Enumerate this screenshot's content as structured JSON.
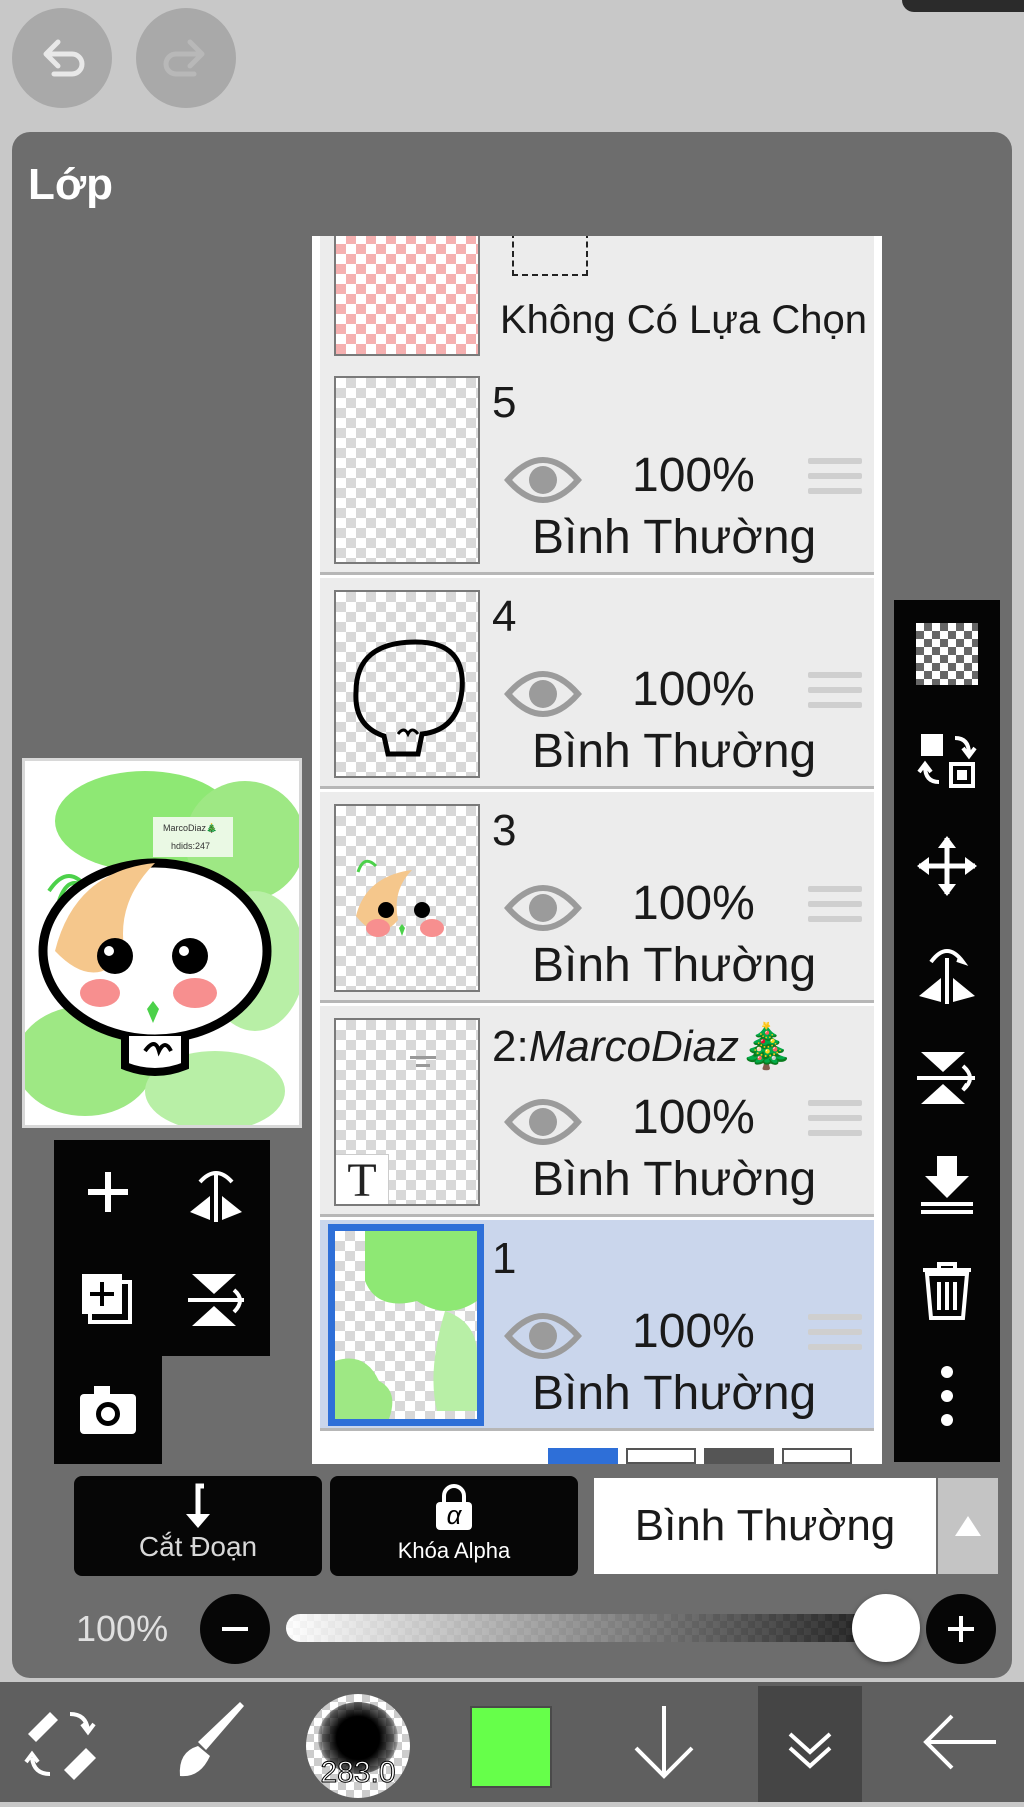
{
  "panel": {
    "title": "Lớp"
  },
  "layers": {
    "selection_layer": {
      "label": "Không Có Lựa Chọn"
    },
    "rows": [
      {
        "name": "5",
        "opacity": "100%",
        "blend": "Bình Thường"
      },
      {
        "name": "4",
        "opacity": "100%",
        "blend": "Bình Thường"
      },
      {
        "name": "3",
        "opacity": "100%",
        "blend": "Bình Thường"
      },
      {
        "name_prefix": "2:",
        "name_italic": "MarcoDiaz",
        "emoji": "🎄",
        "opacity": "100%",
        "blend": "Bình Thường"
      },
      {
        "name": "1",
        "opacity": "100%",
        "blend": "Bình Thường"
      }
    ]
  },
  "preview": {
    "note_line1": "MarcoDiaz🎄",
    "note_line2": "hdids:247"
  },
  "thumb2_text_icon": "T",
  "actions": {
    "clipping_label": "Cắt Đoạn",
    "alpha_lock_label": "Khóa Alpha",
    "alpha_symbol": "α",
    "blend_mode": "Bình Thường"
  },
  "opacity_slider": {
    "label": "100%",
    "value": 1.0
  },
  "bottom": {
    "brush_size": "283.0",
    "color": "#66ff4a"
  },
  "icons": [
    "undo-icon",
    "redo-icon",
    "add-layer-icon",
    "flip-horizontal-icon",
    "add-layer-copy-icon",
    "flip-vertical-icon",
    "camera-icon",
    "transparency-icon",
    "swap-icon",
    "move-icon",
    "mirror-icon",
    "rotate-flip-icon",
    "merge-down-icon",
    "trash-icon",
    "more-icon",
    "eraser-swap-icon",
    "brush-icon",
    "color-swatch",
    "down-arrow-icon",
    "collapse-icon",
    "back-arrow-icon"
  ]
}
